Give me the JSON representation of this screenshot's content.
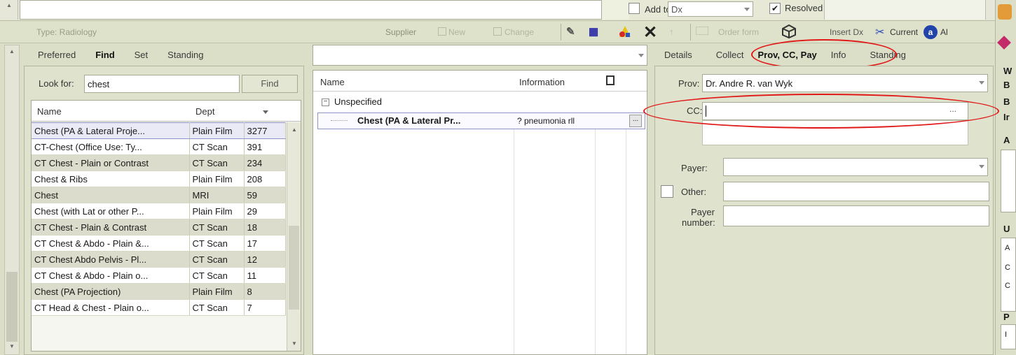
{
  "top": {
    "add_to_label": "Add to",
    "add_to_value": "Dx",
    "resolved_label": "Resolved",
    "resolved_checked": true
  },
  "toolbar": {
    "type_label": "Type: Radiology",
    "supplier_label": "Supplier",
    "new_label": "New",
    "change_label": "Change",
    "order_form_label": "Order form",
    "insert_dx_label": "Insert Dx",
    "current_label": "Current",
    "all_label": "Al"
  },
  "left": {
    "tabs": [
      "Preferred",
      "Find",
      "Set",
      "Standing"
    ],
    "active_tab": "Find",
    "look_for_label": "Look for:",
    "look_for_value": "chest",
    "find_button": "Find",
    "columns": [
      "Name",
      "Dept"
    ],
    "rows": [
      {
        "name": "Chest (PA & Lateral Proje...",
        "dept": "Plain Film",
        "count": "3277"
      },
      {
        "name": "CT-Chest (Office Use: Ty...",
        "dept": "CT Scan",
        "count": "391"
      },
      {
        "name": "CT Chest - Plain or Contrast",
        "dept": "CT Scan",
        "count": "234"
      },
      {
        "name": "Chest & Ribs",
        "dept": "Plain Film",
        "count": "208"
      },
      {
        "name": "Chest",
        "dept": "MRI",
        "count": "59"
      },
      {
        "name": "Chest (with Lat or other P...",
        "dept": "Plain Film",
        "count": "29"
      },
      {
        "name": "CT Chest - Plain & Contrast",
        "dept": "CT Scan",
        "count": "18"
      },
      {
        "name": "CT Chest & Abdo - Plain &...",
        "dept": "CT Scan",
        "count": "17"
      },
      {
        "name": "CT Chest Abdo Pelvis - Pl...",
        "dept": "CT Scan",
        "count": "12"
      },
      {
        "name": "CT Chest & Abdo - Plain o...",
        "dept": "CT Scan",
        "count": "11"
      },
      {
        "name": "Chest (PA Projection)",
        "dept": "Plain Film",
        "count": "8"
      },
      {
        "name": "CT Head & Chest - Plain o...",
        "dept": "CT Scan",
        "count": "7"
      }
    ]
  },
  "middle": {
    "columns": [
      "Name",
      "Information"
    ],
    "group": "Unspecified",
    "item_name": "Chest (PA & Lateral Pr...",
    "item_info": "? pneumonia rll"
  },
  "right": {
    "tabs": [
      "Details",
      "Collect",
      "Prov, CC, Pay",
      "Info",
      "Standing"
    ],
    "active_tab": "Prov, CC, Pay",
    "prov_label": "Prov:",
    "prov_value": "Dr. Andre R. van Wyk",
    "cc_label": "CC:",
    "cc_value": "",
    "payer_label": "Payer:",
    "payer_value": "",
    "other_label": "Other:",
    "payer_number_label_1": "Payer",
    "payer_number_label_2": "number:"
  },
  "far_right": {
    "letters": [
      "W",
      "B",
      "B",
      "Ir",
      "A",
      "U",
      "A",
      "C",
      "C",
      "P",
      "I"
    ]
  }
}
